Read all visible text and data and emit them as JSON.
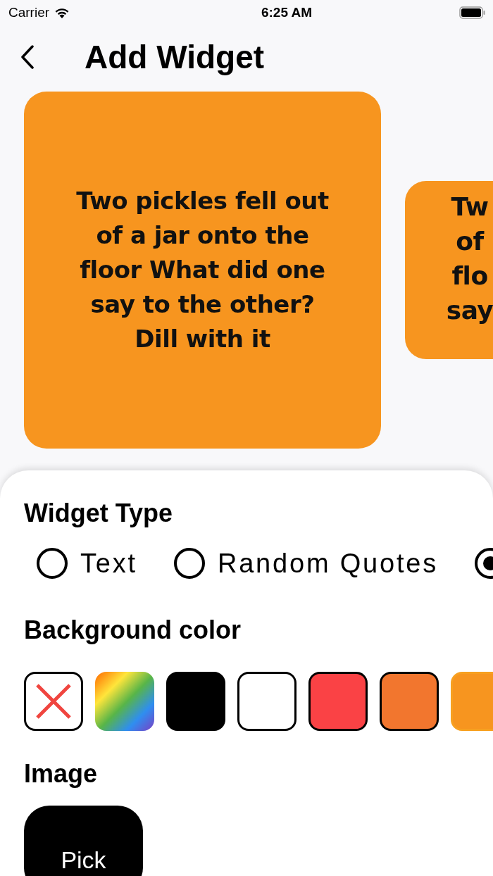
{
  "status_bar": {
    "carrier": "Carrier",
    "time": "6:25 AM"
  },
  "nav": {
    "title": "Add Widget"
  },
  "previews": [
    {
      "lines": [
        "Two pickles fell out",
        "of a jar onto the",
        "floor What did one",
        "say to the other?",
        "Dill with it"
      ]
    },
    {
      "lines": [
        "Tw",
        "of",
        "flo",
        "say"
      ]
    }
  ],
  "widget_type": {
    "heading": "Widget Type",
    "options": [
      {
        "label": "Text",
        "selected": false
      },
      {
        "label": "Random Quotes",
        "selected": false
      },
      {
        "selected": true
      }
    ]
  },
  "background_color": {
    "heading": "Background color",
    "swatches": [
      {
        "kind": "none"
      },
      {
        "kind": "rainbow"
      },
      {
        "kind": "color",
        "color": "#000000"
      },
      {
        "kind": "color",
        "color": "#ffffff"
      },
      {
        "kind": "color",
        "color": "#fa4245"
      },
      {
        "kind": "color",
        "color": "#f2762e"
      },
      {
        "kind": "color",
        "color": "#f7951f"
      }
    ]
  },
  "image": {
    "heading": "Image",
    "button": "Pick"
  }
}
